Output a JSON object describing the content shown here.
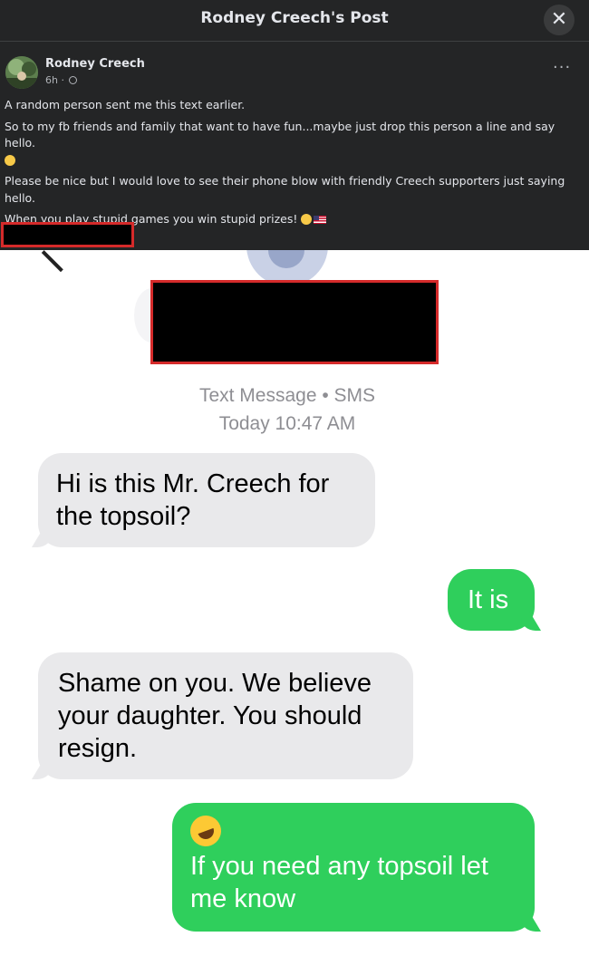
{
  "header": {
    "title": "Rodney Creech's Post",
    "close_label": "✕"
  },
  "post": {
    "author": "Rodney Creech",
    "time": "6h",
    "more_label": "···",
    "paragraphs": [
      "A random person sent me this text earlier.",
      "So to my fb friends and family that want to have fun...maybe just drop this person a line and say hello.",
      "Please be nice but I would love to see their phone blow with friendly Creech supporters just saying hello.",
      "When you play stupid games you win stupid prizes!"
    ]
  },
  "conversation": {
    "service": "Text Message • SMS",
    "timestamp": "Today 10:47 AM",
    "messages": [
      {
        "direction": "incoming",
        "text": "Hi is this Mr. Creech for the topsoil?"
      },
      {
        "direction": "outgoing",
        "text": "It is"
      },
      {
        "direction": "incoming",
        "text": "Shame on you. We believe your daughter. You should resign."
      },
      {
        "direction": "outgoing",
        "emoji": "rolling-on-floor-laughing",
        "text": "If you need any topsoil let me know"
      }
    ]
  },
  "colors": {
    "fb_background": "#242526",
    "incoming_bubble": "#e9e9eb",
    "outgoing_bubble": "#2fcf5c",
    "redaction_border": "#d52a2a"
  }
}
